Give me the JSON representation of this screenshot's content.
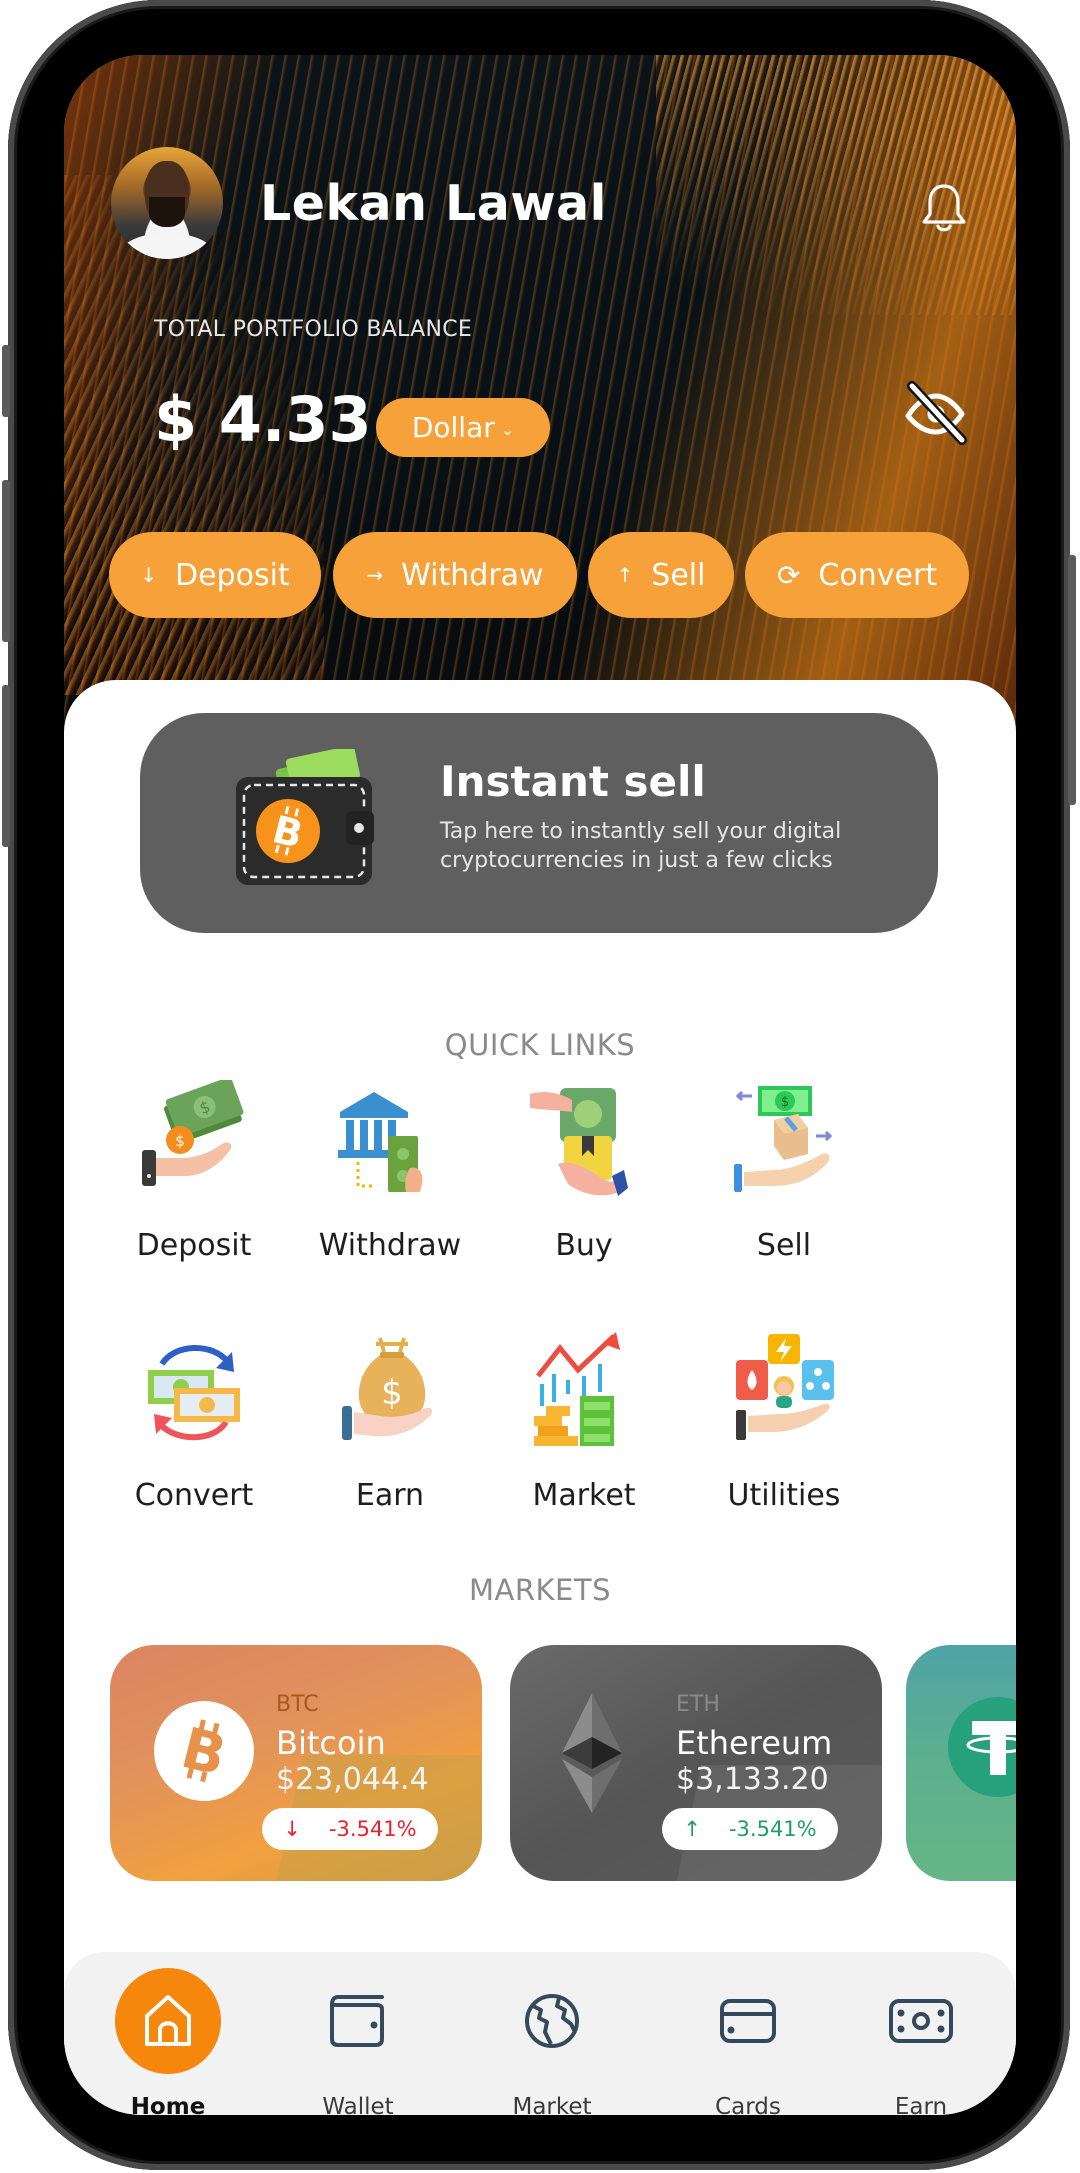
{
  "header": {
    "user_name": "Lekan Lawal",
    "balance_label": "TOTAL PORTFOLIO BALANCE",
    "balance_value": "$ 4.33",
    "currency_selector": "Dollar",
    "icons": {
      "notification": "bell-icon",
      "visibility": "eye-off-icon"
    }
  },
  "actions": [
    {
      "label": "Deposit",
      "icon": "↓"
    },
    {
      "label": "Withdraw",
      "icon": "→"
    },
    {
      "label": "Sell",
      "icon": "↑"
    },
    {
      "label": "Convert",
      "icon": "⟳"
    }
  ],
  "instant_sell": {
    "title": "Instant sell",
    "description": "Tap here to instantly sell your digital cryptocurrencies in just a few clicks"
  },
  "quick_links": {
    "title": "QUICK LINKS",
    "items": [
      {
        "label": "Deposit"
      },
      {
        "label": "Withdraw"
      },
      {
        "label": "Buy"
      },
      {
        "label": "Sell"
      },
      {
        "label": "Convert"
      },
      {
        "label": "Earn"
      },
      {
        "label": "Market"
      },
      {
        "label": "Utilities"
      }
    ]
  },
  "markets": {
    "title": "MARKETS",
    "cards": [
      {
        "symbol": "BTC",
        "name": "Bitcoin",
        "price": "$23,044.4",
        "change": "-3.541%",
        "direction_arrow": "↓",
        "change_color": "#e8222e"
      },
      {
        "symbol": "ETH",
        "name": "Ethereum",
        "price": "$3,133.20",
        "change": "-3.541%",
        "direction_arrow": "↑",
        "change_color": "#1e9e6e"
      },
      {
        "symbol": "USDT",
        "name": "",
        "price": "",
        "change": ""
      }
    ]
  },
  "bottom_nav": {
    "items": [
      {
        "label": "Home",
        "active": true
      },
      {
        "label": "Wallet"
      },
      {
        "label": "Market"
      },
      {
        "label": "Cards"
      },
      {
        "label": "Earn"
      }
    ]
  },
  "colors": {
    "accent": "#f7a13a",
    "nav_active": "#f5870c",
    "card_dark": "#5f5f5f"
  }
}
